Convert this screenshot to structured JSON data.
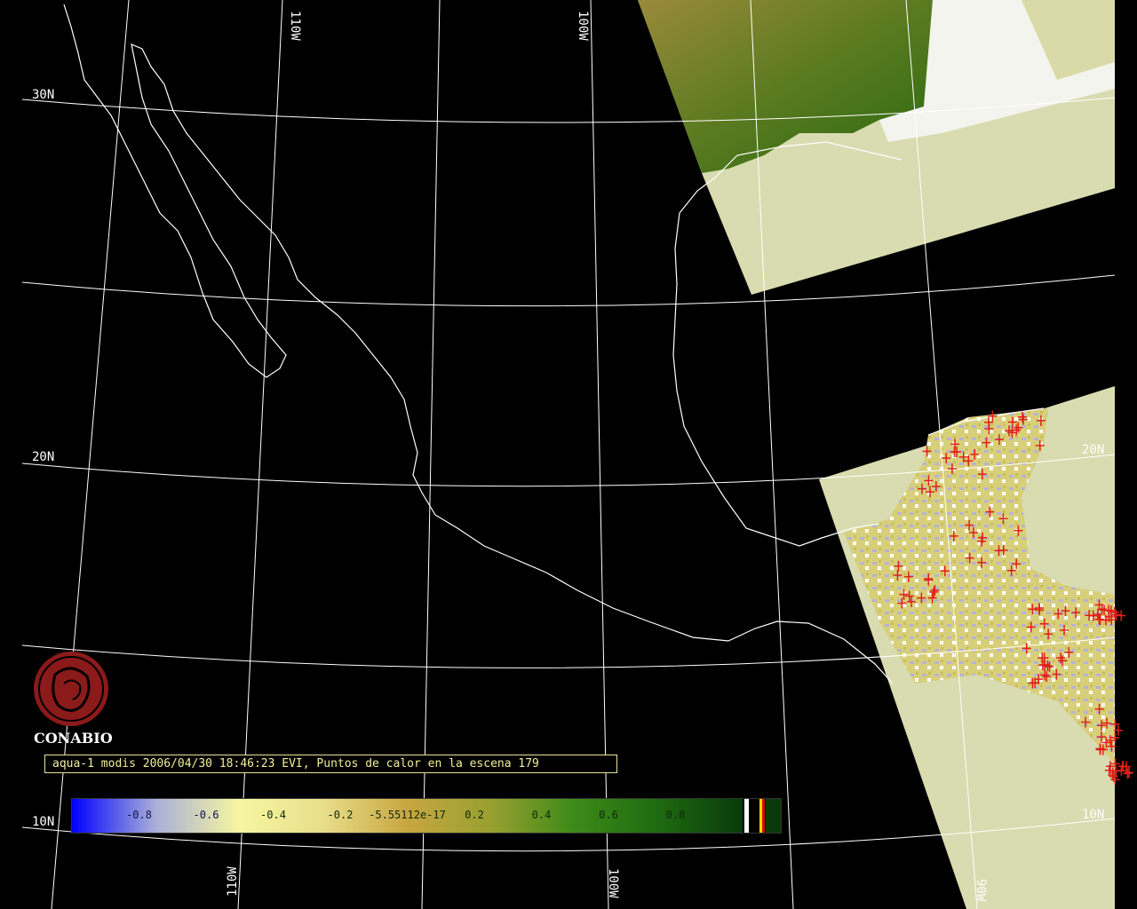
{
  "map": {
    "longitude_labels_top": [
      "110W",
      "100W"
    ],
    "longitude_labels_bottom": [
      "110W",
      "100W",
      "90W"
    ],
    "latitude_labels_left": [
      "30N",
      "20N",
      "10N"
    ],
    "latitude_labels_right": [
      "20N",
      "10N"
    ]
  },
  "branding": {
    "org_name": "CONABIO",
    "logo_color": "#8b1a1a"
  },
  "scene": {
    "title": "aqua-1 modis 2006/04/30 18:46:23 EVI, Puntos de calor en la escena 179",
    "hotspot_count": 179,
    "hotspot_color": "#e0201a",
    "no_data_color": "#d8dcb0"
  },
  "legend": {
    "ticks": [
      "-0.8",
      "-0.6",
      "-0.4",
      "-0.2",
      "-5.55112e-17",
      "0.2",
      "0.4",
      "0.6",
      "0.8"
    ],
    "tick_values": [
      -0.8,
      -0.6,
      -0.4,
      -0.2,
      0,
      0.2,
      0.4,
      0.6,
      0.8
    ],
    "range": [
      -1,
      1
    ],
    "colors": [
      "#0000ff",
      "#aab0d8",
      "#f6f6a0",
      "#e8de8a",
      "#c8a640",
      "#98a030",
      "#3c8a18",
      "#1e6a10",
      "#0a3a0a"
    ]
  }
}
